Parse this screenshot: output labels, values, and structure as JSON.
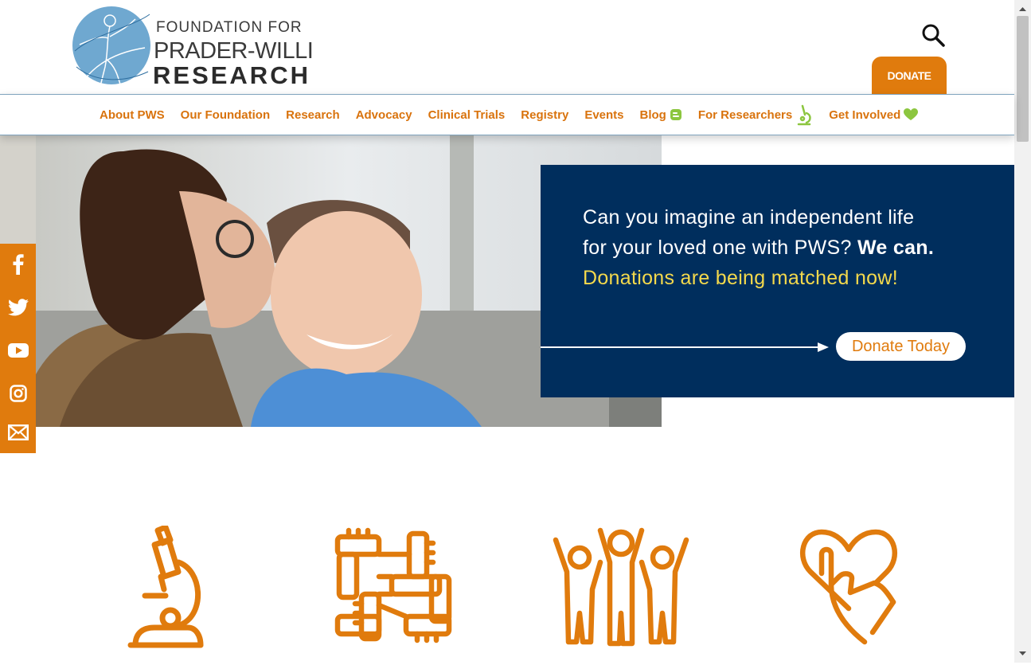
{
  "logo": {
    "line1": "FOUNDATION FOR",
    "line2": "PRADER-WILLI",
    "line3": "RESEARCH"
  },
  "header": {
    "search_icon": "search-icon",
    "donate_label": "DONATE"
  },
  "nav": {
    "items": [
      {
        "label": "About PWS"
      },
      {
        "label": "Our Foundation"
      },
      {
        "label": "Research"
      },
      {
        "label": "Advocacy"
      },
      {
        "label": "Clinical Trials"
      },
      {
        "label": "Registry"
      },
      {
        "label": "Events"
      },
      {
        "label": "Blog",
        "icon": "blog-icon"
      },
      {
        "label": "For Researchers",
        "icon": "microscope-icon"
      },
      {
        "label": "Get Involved",
        "icon": "heart-icon"
      }
    ]
  },
  "hero": {
    "line1": "Can you imagine an independent life",
    "line2_regular": "for your loved one with PWS? ",
    "line2_bold": "We can.",
    "line3": "Donations are being matched now!",
    "cta_label": "Donate Today"
  },
  "social": {
    "icons": [
      "facebook-icon",
      "twitter-icon",
      "youtube-icon",
      "instagram-icon",
      "email-icon"
    ]
  },
  "features": {
    "icons": [
      "microscope-icon",
      "hands-together-icon",
      "community-people-icon",
      "heart-hand-icon"
    ]
  },
  "colors": {
    "accent_orange": "#e07b0d",
    "navy": "#002e5d",
    "highlight_yellow": "#f4d94c",
    "nav_green": "#8cc63f"
  }
}
